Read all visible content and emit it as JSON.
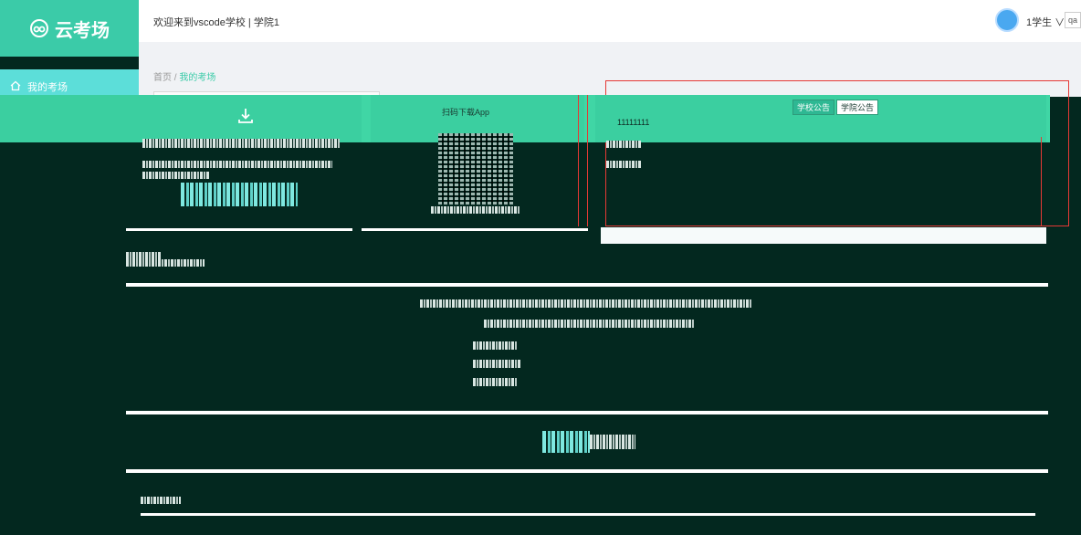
{
  "brand": {
    "name": "云考场"
  },
  "sidebar": {
    "items": [
      {
        "label": "我的考场"
      }
    ]
  },
  "header": {
    "welcome": "欢迎来到vscode学校 | 学院1",
    "user": "1学生 ∨",
    "lang": "qa"
  },
  "breadcrumb": {
    "home": "首页",
    "sep": "/",
    "current": "我的考场"
  },
  "qr": {
    "title": "扫码下载App"
  },
  "notice": {
    "tabs": [
      {
        "label": "学校公告",
        "active": true
      },
      {
        "label": "学院公告",
        "active": false
      }
    ],
    "content": "11111111"
  },
  "colors": {
    "brand": "#3bcba8",
    "nav_active": "#5cded9",
    "dark_bg": "#03281f"
  }
}
